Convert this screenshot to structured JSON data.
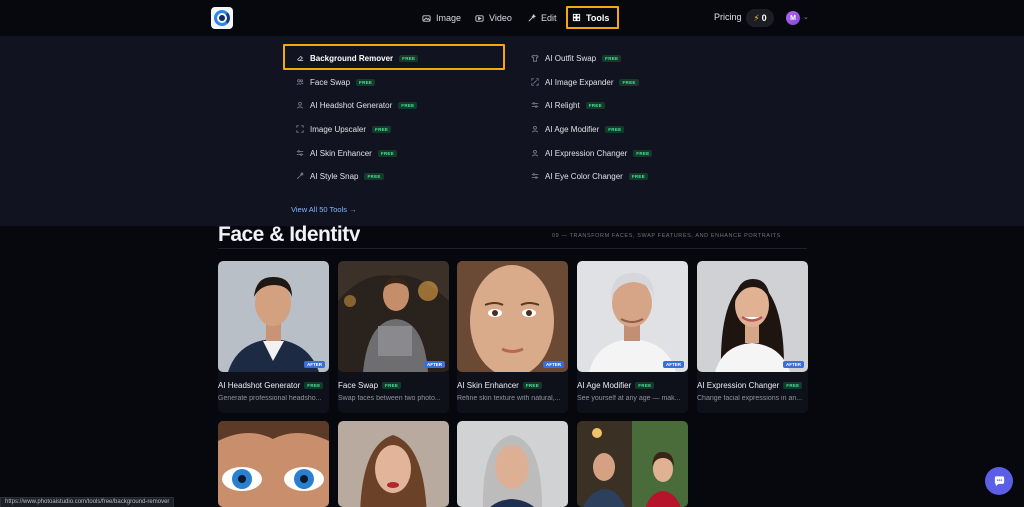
{
  "nav": {
    "image": "Image",
    "video": "Video",
    "edit": "Edit",
    "tools": "Tools",
    "pricing": "Pricing",
    "credits": "0",
    "avatar_initial": "M"
  },
  "dropdown": {
    "left_column": [
      {
        "label": "Background Remover",
        "badge": "FREE",
        "icon": "eraser-icon"
      },
      {
        "label": "Face Swap",
        "badge": "FREE",
        "icon": "users-icon"
      },
      {
        "label": "AI Headshot Generator",
        "badge": "FREE",
        "icon": "user-icon"
      },
      {
        "label": "Image Upscaler",
        "badge": "FREE",
        "icon": "expand-icon"
      },
      {
        "label": "AI Skin Enhancer",
        "badge": "FREE",
        "icon": "sliders-icon"
      },
      {
        "label": "AI Style Snap",
        "badge": "FREE",
        "icon": "wand-icon"
      }
    ],
    "right_column": [
      {
        "label": "AI Outfit Swap",
        "badge": "FREE",
        "icon": "shirt-icon"
      },
      {
        "label": "AI Image Expander",
        "badge": "FREE",
        "icon": "expand-icon"
      },
      {
        "label": "AI Relight",
        "badge": "FREE",
        "icon": "sliders-icon"
      },
      {
        "label": "AI Age Modifier",
        "badge": "FREE",
        "icon": "user-icon"
      },
      {
        "label": "AI Expression Changer",
        "badge": "FREE",
        "icon": "user-icon"
      },
      {
        "label": "AI Eye Color Changer",
        "badge": "FREE",
        "icon": "sliders-icon"
      }
    ],
    "view_all": "View All 50 Tools →"
  },
  "section": {
    "title": "Face & Identity",
    "subtitle": "09 — TRANSFORM FACES, SWAP FEATURES, AND ENHANCE PORTRAITS"
  },
  "cards": [
    {
      "title": "AI Headshot Generator",
      "badge": "FREE",
      "tag": "AFTER",
      "desc": "Generate professional headsho..."
    },
    {
      "title": "Face Swap",
      "badge": "FREE",
      "tag": "AFTER",
      "desc": "Swap faces between two photo..."
    },
    {
      "title": "AI Skin Enhancer",
      "badge": "FREE",
      "tag": "AFTER",
      "desc": "Refine skin texture with natural,..."
    },
    {
      "title": "AI Age Modifier",
      "badge": "FREE",
      "tag": "AFTER",
      "desc": "See yourself at any age — mak..."
    },
    {
      "title": "AI Expression Changer",
      "badge": "FREE",
      "tag": "AFTER",
      "desc": "Change facial expressions in an..."
    }
  ],
  "status_url": "https://www.photoaistudio.com/tools/free/background-remover",
  "colors": {
    "accent_highlight": "#f5a80c",
    "free_badge": "#4be39a",
    "after_tag": "#3a6fd9",
    "chat_button": "#5b5fe6"
  }
}
